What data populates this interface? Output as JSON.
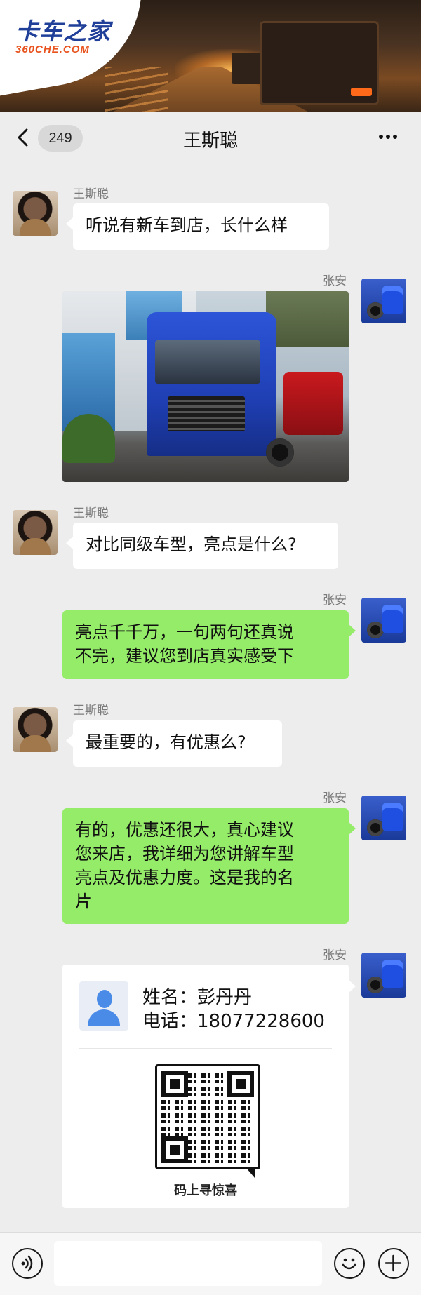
{
  "banner": {
    "logo_cn": "卡车之家",
    "logo_en": "360CHE.COM"
  },
  "header": {
    "back_icon": "chevron-left-icon",
    "unread_count": "249",
    "title": "王斯聪",
    "more_icon": "more-dots-icon"
  },
  "messages": [
    {
      "side": "left",
      "sender": "王斯聪",
      "type": "text",
      "text": "听说有新车到店，长什么样"
    },
    {
      "side": "right",
      "sender": "张安",
      "type": "image"
    },
    {
      "side": "left",
      "sender": "王斯聪",
      "type": "text",
      "text": "对比同级车型，亮点是什么?"
    },
    {
      "side": "right",
      "sender": "张安",
      "type": "text",
      "lines": [
        "亮点千千万，一句两句还真说",
        "不完，建议您到店真实感受下"
      ]
    },
    {
      "side": "left",
      "sender": "王斯聪",
      "type": "text",
      "text": "最重要的，有优惠么?"
    },
    {
      "side": "right",
      "sender": "张安",
      "type": "text",
      "lines": [
        "有的，优惠还很大，真心建议",
        "您来店，我详细为您讲解车型",
        "亮点及优惠力度。这是我的名",
        "片"
      ]
    },
    {
      "side": "right",
      "sender": "张安",
      "type": "card"
    }
  ],
  "card": {
    "name_line": "姓名：彭丹丹",
    "phone_line": "电话：18077228600",
    "qr_caption": "码上寻惊喜"
  },
  "bottom_bar": {
    "voice_icon": "voice-icon",
    "emoji_icon": "emoji-icon",
    "plus_icon": "plus-icon"
  },
  "colors": {
    "background": "#ededed",
    "green_bubble": "#95ec69",
    "white_bubble": "#ffffff",
    "logo_blue": "#1f3f99",
    "logo_orange": "#e8531e"
  }
}
